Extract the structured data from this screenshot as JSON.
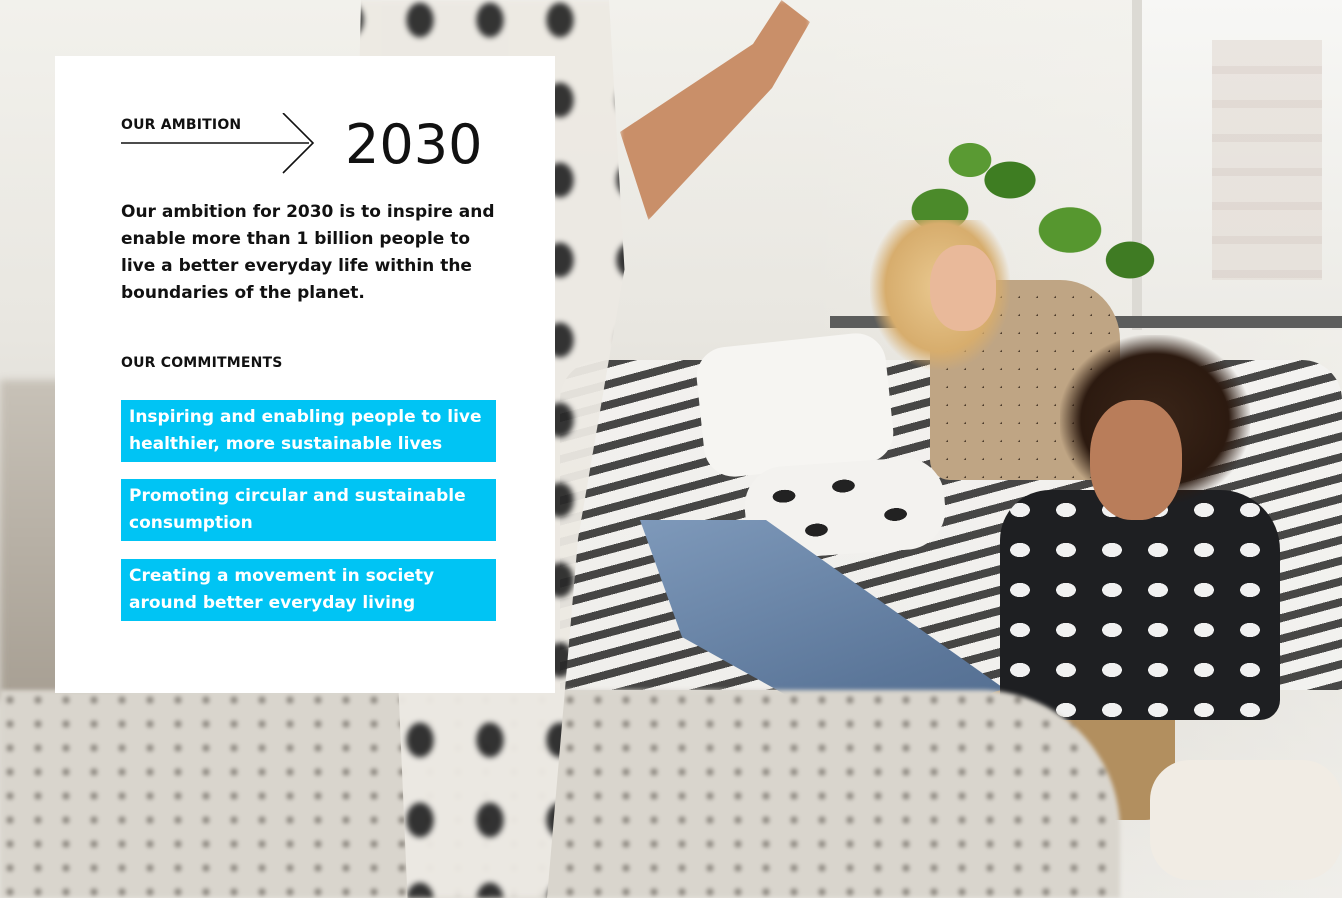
{
  "card": {
    "ambition_label": "OUR AMBITION",
    "year": "2030",
    "ambition_text": "Our ambition for 2030 is to inspire and enable more than 1 billion people to live a better everyday life within the boundaries of the planet.",
    "commitments_label": "OUR COMMITMENTS",
    "commitments": [
      "Inspiring and enabling people to live healthier, more sustainable lives",
      "Promoting circular and sustainable consumption",
      "Creating a movement in society around better everyday living"
    ]
  },
  "colors": {
    "accent": "#00c4f4",
    "card_bg": "#ffffff",
    "text": "#111111"
  },
  "icons": {
    "arrow": "arrow-right-icon"
  }
}
